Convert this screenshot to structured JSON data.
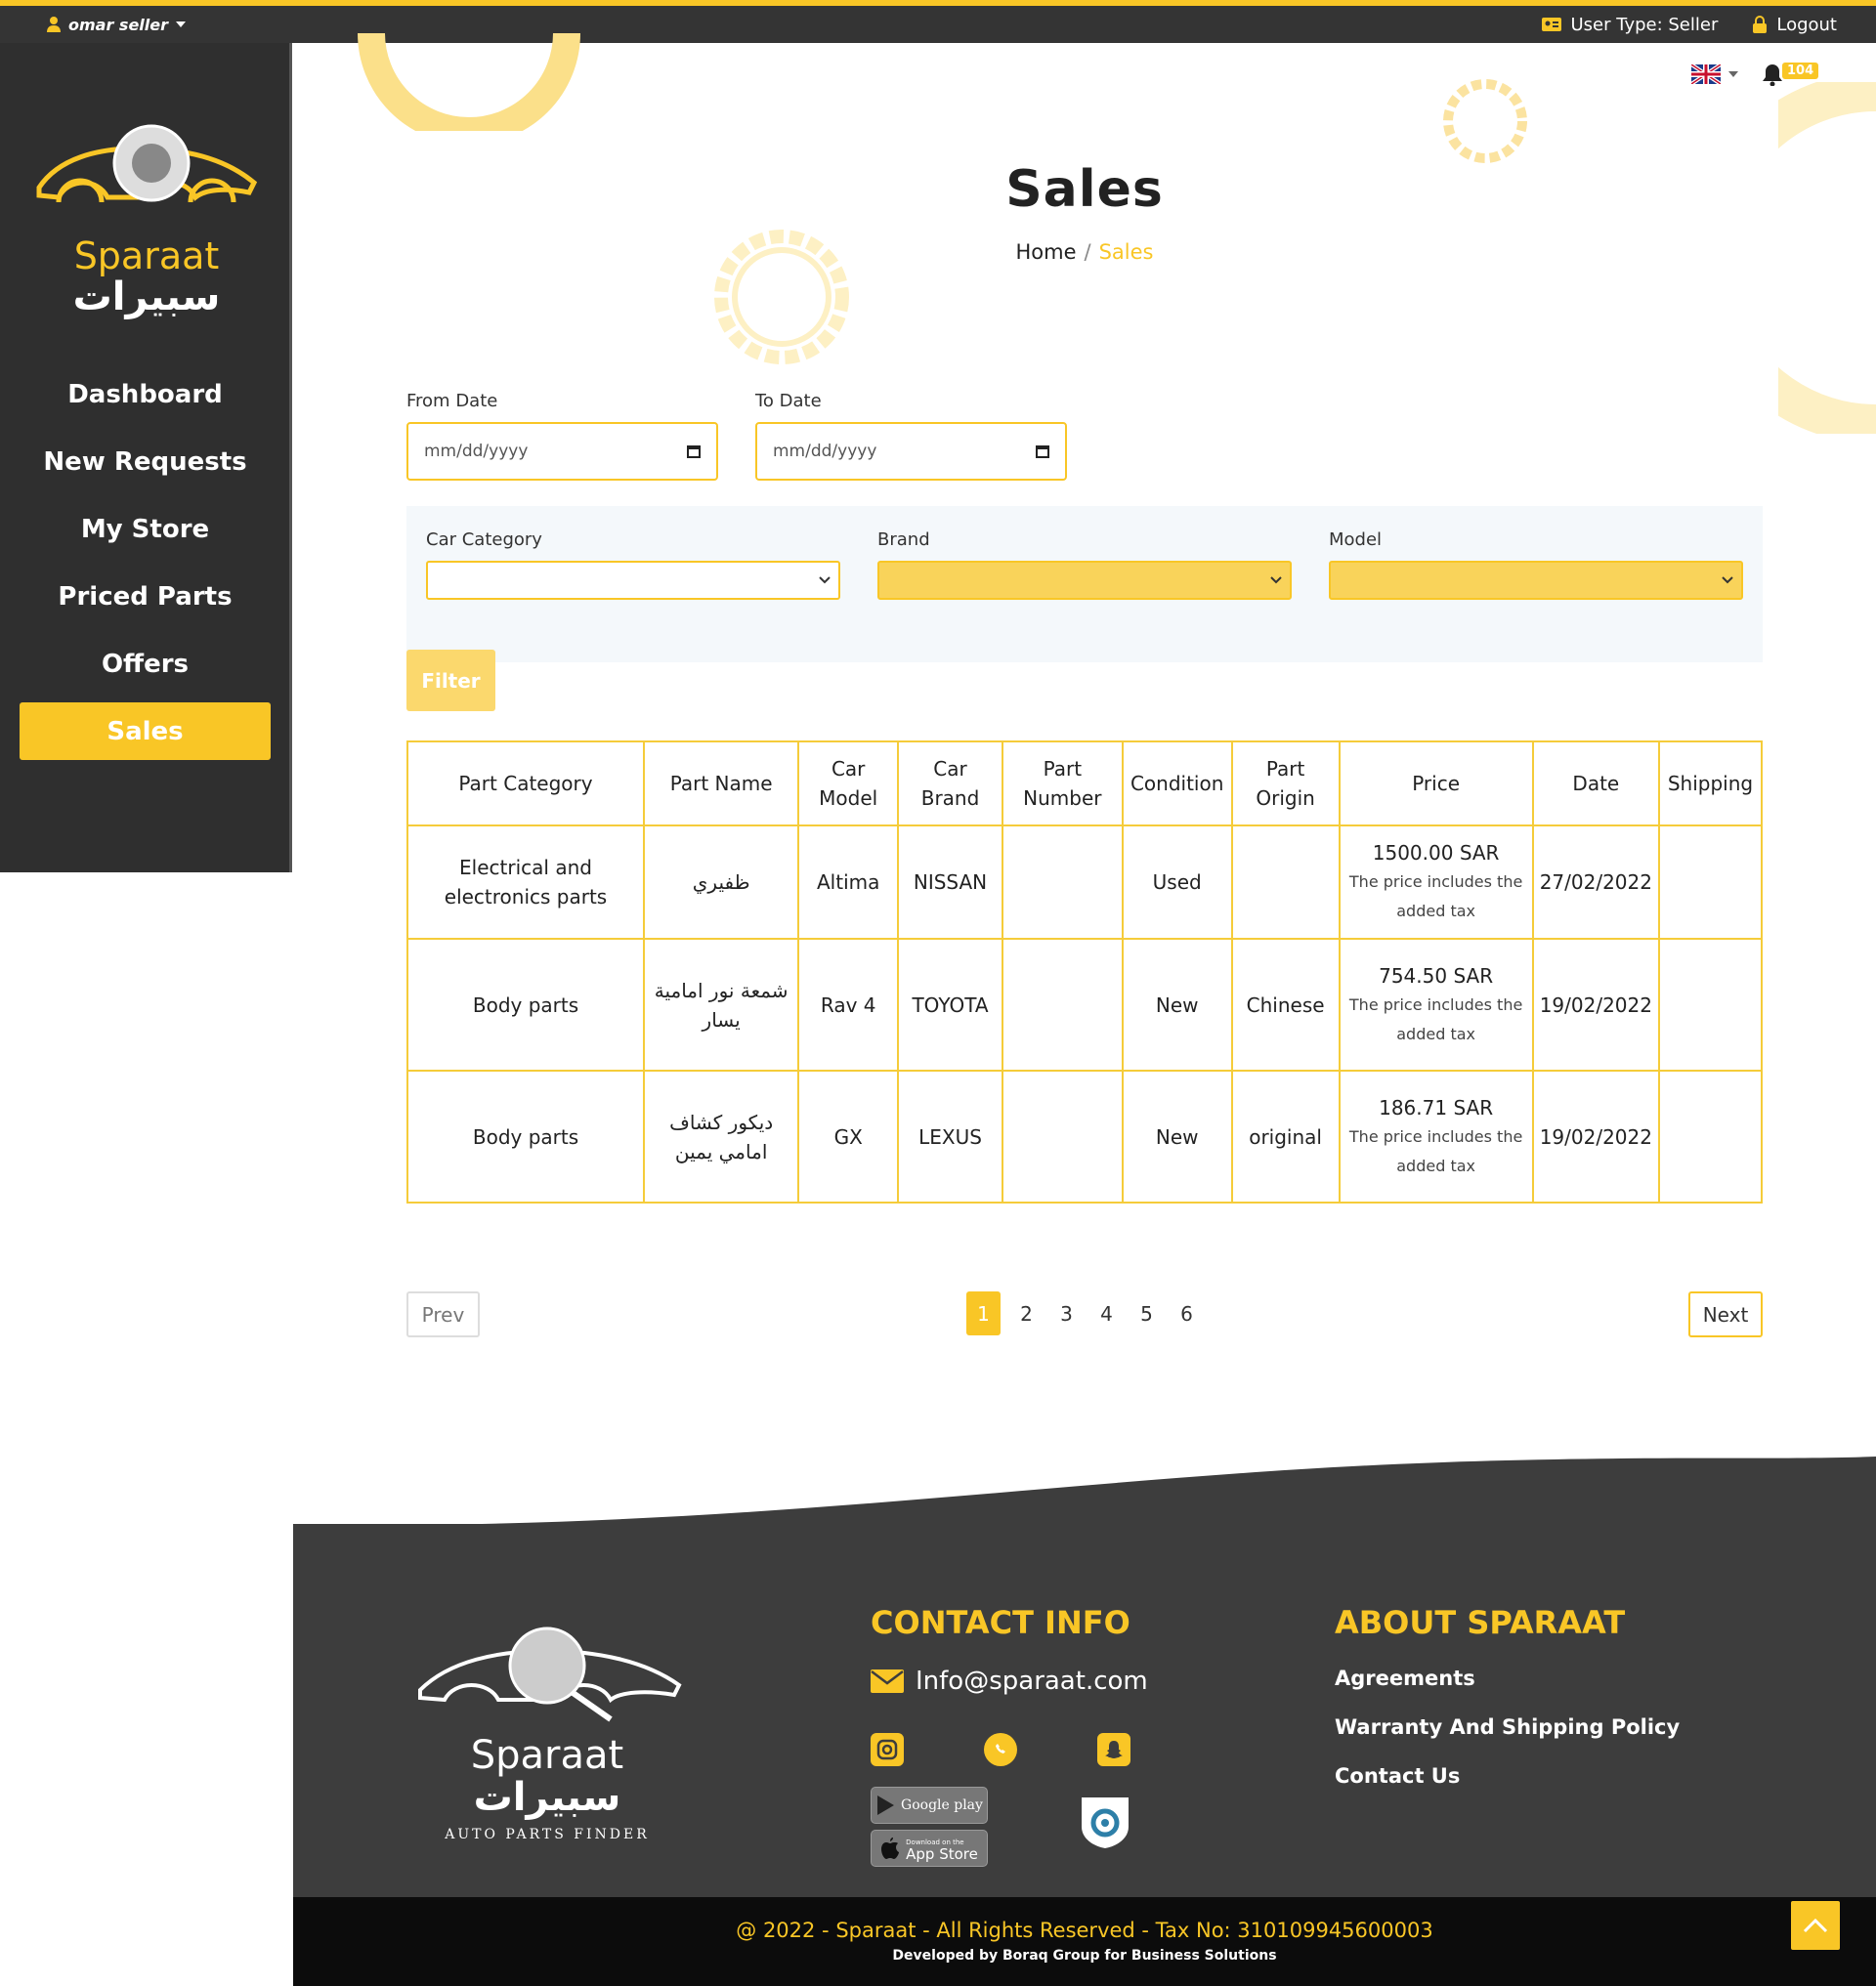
{
  "topbar": {
    "user_name": "omar seller",
    "user_type": "User Type: Seller",
    "logout": "Logout"
  },
  "sidebar": {
    "logo_en": "Sparaat",
    "logo_ar": "سبيرات",
    "items": [
      {
        "label": "Dashboard"
      },
      {
        "label": "New Requests"
      },
      {
        "label": "My Store"
      },
      {
        "label": "Priced Parts"
      },
      {
        "label": "Offers"
      },
      {
        "label": "Sales"
      }
    ]
  },
  "header": {
    "title": "Sales",
    "breadcrumb_home": "Home",
    "breadcrumb_sep": "/",
    "breadcrumb_current": "Sales",
    "notification_count": "104"
  },
  "filters": {
    "from_date_label": "From Date",
    "to_date_label": "To Date",
    "date_placeholder": "mm/dd/yyyy",
    "car_category_label": "Car Category",
    "brand_label": "Brand",
    "model_label": "Model",
    "filter_button": "Filter"
  },
  "table": {
    "headers": [
      {
        "line1": "Part Category",
        "line2": ""
      },
      {
        "line1": "Part Name",
        "line2": ""
      },
      {
        "line1": "Car",
        "line2": "Model"
      },
      {
        "line1": "Car",
        "line2": "Brand"
      },
      {
        "line1": "Part",
        "line2": "Number"
      },
      {
        "line1": "Condition",
        "line2": ""
      },
      {
        "line1": "Part",
        "line2": "Origin"
      },
      {
        "line1": "Price",
        "line2": ""
      },
      {
        "line1": "Date",
        "line2": ""
      },
      {
        "line1": "Shipping",
        "line2": ""
      }
    ],
    "tax_note_1": "The price includes the",
    "tax_note_2": "added tax",
    "rows": [
      {
        "category_1": "Electrical and",
        "category_2": "electronics parts",
        "name_1": "ظفيري",
        "name_2": "",
        "model": "Altima",
        "brand": "NISSAN",
        "number": "",
        "condition": "Used",
        "origin": "",
        "price": "1500.00 SAR",
        "date": "27/02/2022",
        "shipping": ""
      },
      {
        "category_1": "Body parts",
        "category_2": "",
        "name_1": "شمعة نور امامية",
        "name_2": "يسار",
        "model": "Rav 4",
        "brand": "TOYOTA",
        "number": "",
        "condition": "New",
        "origin": "Chinese",
        "price": "754.50 SAR",
        "date": "19/02/2022",
        "shipping": ""
      },
      {
        "category_1": "Body parts",
        "category_2": "",
        "name_1": "ديكور كشاف",
        "name_2": "امامي يمين",
        "model": "GX",
        "brand": "LEXUS",
        "number": "",
        "condition": "New",
        "origin": "original",
        "price": "186.71 SAR",
        "date": "19/02/2022",
        "shipping": ""
      }
    ]
  },
  "pagination": {
    "prev": "Prev",
    "next": "Next",
    "pages": [
      "1",
      "2",
      "3",
      "4",
      "5",
      "6"
    ],
    "current": "1"
  },
  "footer": {
    "logo_en": "Sparaat",
    "logo_ar": "سبيرات",
    "tagline": "AUTO PARTS FINDER",
    "contact_heading": "CONTACT INFO",
    "email": "Info@sparaat.com",
    "google_play": "Google play",
    "app_store_small": "Download on the",
    "app_store": "App Store",
    "about_heading": "ABOUT SPARAAT",
    "links": [
      {
        "label": "Agreements"
      },
      {
        "label": "Warranty And Shipping Policy"
      },
      {
        "label": "Contact Us"
      }
    ],
    "copyright": "@ 2022 - Sparaat - All Rights Reserved - Tax No: 310109945600003",
    "developer": "Developed by Boraq Group for Business Solutions"
  },
  "colors": {
    "accent": "#f9c626",
    "dark": "#343434",
    "footer_bg": "#3d3d3d"
  },
  "icons": [
    "user-icon",
    "id-card-icon",
    "lock-icon",
    "uk-flag-icon",
    "bell-icon",
    "calendar-icon",
    "chevron-down-icon",
    "envelope-icon",
    "instagram-icon",
    "whatsapp-icon",
    "snapchat-icon",
    "arrow-up-icon"
  ]
}
